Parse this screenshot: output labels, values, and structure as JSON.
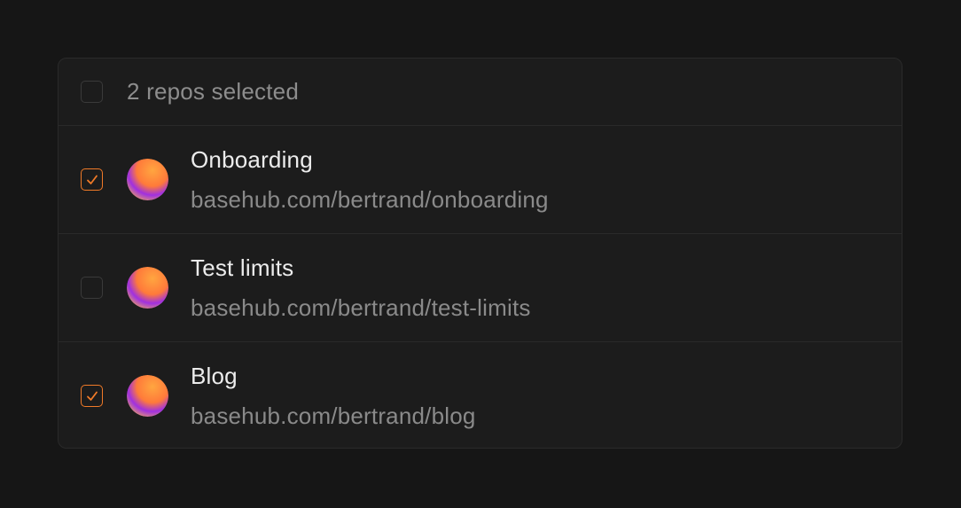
{
  "header": {
    "label": "2 repos selected",
    "checked": false
  },
  "colors": {
    "accent": "#f07a28",
    "background": "#161616",
    "panel": "#1c1c1c",
    "avatar_gradient": [
      "#ffa640",
      "#ff7a3a",
      "#a030e0",
      "#f5b84a"
    ]
  },
  "repos": [
    {
      "title": "Onboarding",
      "url": "basehub.com/bertrand/onboarding",
      "checked": true,
      "avatar_icon": "repo-avatar-orb"
    },
    {
      "title": "Test limits",
      "url": "basehub.com/bertrand/test-limits",
      "checked": false,
      "avatar_icon": "repo-avatar-orb"
    },
    {
      "title": "Blog",
      "url": "basehub.com/bertrand/blog",
      "checked": true,
      "avatar_icon": "repo-avatar-orb"
    }
  ]
}
